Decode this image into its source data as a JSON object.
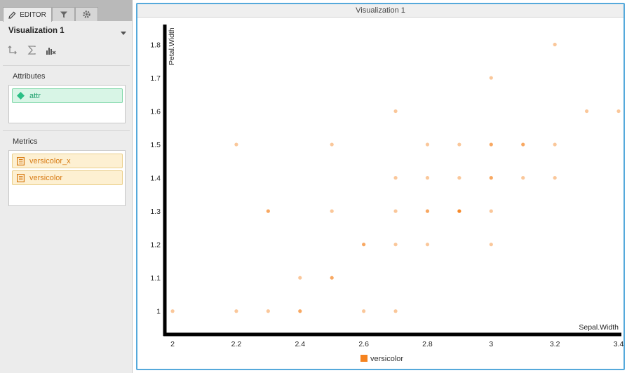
{
  "editor": {
    "tabs": [
      {
        "label": "EDITOR",
        "icon": "pencil-icon",
        "active": true
      },
      {
        "label": "",
        "icon": "filter-icon",
        "active": false
      },
      {
        "label": "",
        "icon": "gear-icon",
        "active": false
      }
    ],
    "viz_title": "Visualization 1",
    "toolbar": [
      {
        "icon": "swap-axes-icon"
      },
      {
        "icon": "sigma-icon"
      },
      {
        "icon": "chart-clear-icon"
      }
    ],
    "attributes_label": "Attributes",
    "attributes": [
      "attr"
    ],
    "metrics_label": "Metrics",
    "metrics": [
      "versicolor_x",
      "versicolor"
    ]
  },
  "colors": {
    "accent_border": "#55a9db",
    "attr_green": "#1a9e6a",
    "metric_orange": "#d77a12",
    "point_orange": "#f5831f"
  },
  "viz_panel": {
    "title": "Visualization 1"
  },
  "chart_data": {
    "type": "scatter",
    "title": "",
    "xlabel": "Sepal.Width",
    "ylabel": "Petal.Width",
    "xlim": [
      1.98,
      3.4
    ],
    "ylim": [
      0.93,
      1.86
    ],
    "x_ticks": [
      "2",
      "2.2",
      "2.4",
      "2.6",
      "2.8",
      "3",
      "3.2",
      "3.4"
    ],
    "y_ticks": [
      "1",
      "1.1",
      "1.2",
      "1.3",
      "1.4",
      "1.5",
      "1.6",
      "1.7",
      "1.8"
    ],
    "grid": false,
    "legend_position": "bottom",
    "series": [
      {
        "name": "versicolor",
        "color": "#f5831f",
        "points": [
          {
            "x": 2.0,
            "y": 1.0,
            "n": 1
          },
          {
            "x": 2.2,
            "y": 1.0,
            "n": 1
          },
          {
            "x": 2.3,
            "y": 1.0,
            "n": 1
          },
          {
            "x": 2.4,
            "y": 1.0,
            "n": 2
          },
          {
            "x": 2.6,
            "y": 1.0,
            "n": 1
          },
          {
            "x": 2.7,
            "y": 1.0,
            "n": 1
          },
          {
            "x": 2.4,
            "y": 1.1,
            "n": 1
          },
          {
            "x": 2.5,
            "y": 1.1,
            "n": 2
          },
          {
            "x": 2.6,
            "y": 1.2,
            "n": 2
          },
          {
            "x": 2.7,
            "y": 1.2,
            "n": 1
          },
          {
            "x": 2.8,
            "y": 1.2,
            "n": 1
          },
          {
            "x": 3.0,
            "y": 1.2,
            "n": 1
          },
          {
            "x": 2.3,
            "y": 1.3,
            "n": 2
          },
          {
            "x": 2.5,
            "y": 1.3,
            "n": 1
          },
          {
            "x": 2.7,
            "y": 1.3,
            "n": 1
          },
          {
            "x": 2.8,
            "y": 1.3,
            "n": 2
          },
          {
            "x": 2.9,
            "y": 1.3,
            "n": 3
          },
          {
            "x": 3.0,
            "y": 1.3,
            "n": 1
          },
          {
            "x": 2.7,
            "y": 1.4,
            "n": 1
          },
          {
            "x": 2.8,
            "y": 1.4,
            "n": 1
          },
          {
            "x": 2.9,
            "y": 1.4,
            "n": 1
          },
          {
            "x": 3.0,
            "y": 1.4,
            "n": 2
          },
          {
            "x": 3.1,
            "y": 1.4,
            "n": 1
          },
          {
            "x": 3.2,
            "y": 1.4,
            "n": 1
          },
          {
            "x": 2.2,
            "y": 1.5,
            "n": 1
          },
          {
            "x": 2.5,
            "y": 1.5,
            "n": 1
          },
          {
            "x": 2.8,
            "y": 1.5,
            "n": 1
          },
          {
            "x": 2.9,
            "y": 1.5,
            "n": 1
          },
          {
            "x": 3.0,
            "y": 1.5,
            "n": 2
          },
          {
            "x": 3.1,
            "y": 1.5,
            "n": 2
          },
          {
            "x": 3.2,
            "y": 1.5,
            "n": 1
          },
          {
            "x": 2.7,
            "y": 1.6,
            "n": 1
          },
          {
            "x": 3.3,
            "y": 1.6,
            "n": 1
          },
          {
            "x": 3.4,
            "y": 1.6,
            "n": 1
          },
          {
            "x": 3.0,
            "y": 1.7,
            "n": 1
          },
          {
            "x": 3.2,
            "y": 1.8,
            "n": 1
          }
        ]
      }
    ]
  }
}
